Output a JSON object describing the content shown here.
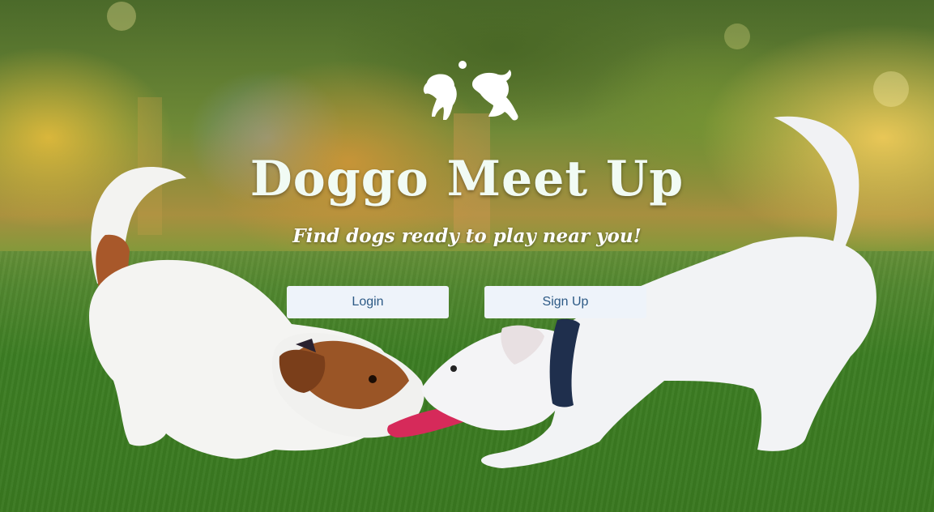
{
  "hero": {
    "title": "Doggo Meet Up",
    "tagline": "Find dogs ready to play near you!"
  },
  "actions": {
    "login_label": "Login",
    "signup_label": "Sign Up"
  },
  "logo": {
    "icon": "two-dogs-playing-ball-icon"
  },
  "colors": {
    "title_text": "#f1fbf4",
    "button_bg": "#eef3fa",
    "button_text": "#2d5a86"
  }
}
